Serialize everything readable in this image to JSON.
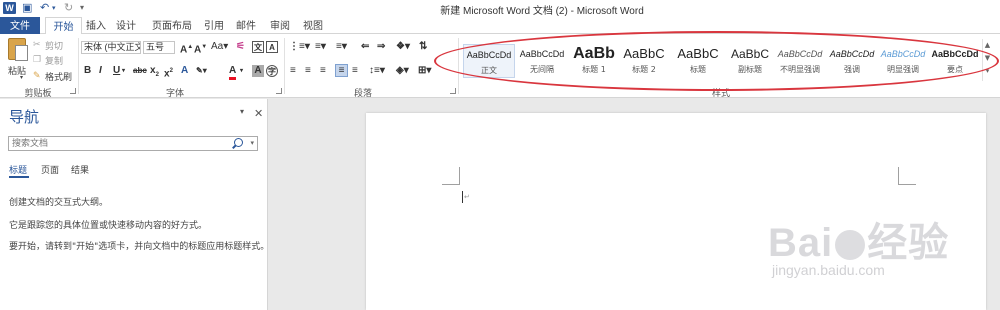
{
  "window": {
    "title": "新建 Microsoft Word 文档 (2) - Microsoft Word",
    "app_icon": "W"
  },
  "quick_access": {
    "save_icon": "save-icon",
    "undo_icon": "undo-icon",
    "redo_icon": "redo-icon",
    "customize_icon": "customize-icon"
  },
  "tabs": [
    {
      "label": "文件"
    },
    {
      "label": "开始"
    },
    {
      "label": "插入"
    },
    {
      "label": "设计"
    },
    {
      "label": "页面布局"
    },
    {
      "label": "引用"
    },
    {
      "label": "邮件"
    },
    {
      "label": "审阅"
    },
    {
      "label": "视图"
    }
  ],
  "clipboard": {
    "paste": "粘贴",
    "cut": "剪切",
    "copy": "复制",
    "format_painter": "格式刷",
    "group_label": "剪贴板"
  },
  "font": {
    "font_name": "宋体 (中文正文",
    "font_size": "五号",
    "group_label": "字体"
  },
  "paragraph": {
    "group_label": "段落"
  },
  "styles": {
    "group_label": "样式",
    "items": [
      {
        "sample": "AaBbCcDd",
        "name": "正文"
      },
      {
        "sample": "AaBbCcDd",
        "name": "无间隔"
      },
      {
        "sample": "AaBb",
        "name": "标题 1"
      },
      {
        "sample": "AaBbC",
        "name": "标题 2"
      },
      {
        "sample": "AaBbC",
        "name": "标题"
      },
      {
        "sample": "AaBbC",
        "name": "副标题"
      },
      {
        "sample": "AaBbCcDd",
        "name": "不明显强调"
      },
      {
        "sample": "AaBbCcDd",
        "name": "强调"
      },
      {
        "sample": "AaBbCcDd",
        "name": "明显强调"
      },
      {
        "sample": "AaBbCcDd",
        "name": "要点"
      }
    ],
    "highlight_color": "#d9363e"
  },
  "navigation": {
    "title": "导航",
    "search_placeholder": "搜索文档",
    "tabs": [
      {
        "label": "标题"
      },
      {
        "label": "页面"
      },
      {
        "label": "结果"
      }
    ],
    "messages": [
      "创建文档的交互式大纲。",
      "它是跟踪您的具体位置或快速移动内容的好方式。",
      "要开始，请转到\"开始\"选项卡，并向文档中的标题应用标题样式。"
    ]
  },
  "watermark": {
    "brand_pre": "Bai",
    "brand_post": "经验",
    "url": "jingyan.baidu.com"
  },
  "colors": {
    "accent": "#2b579a"
  }
}
